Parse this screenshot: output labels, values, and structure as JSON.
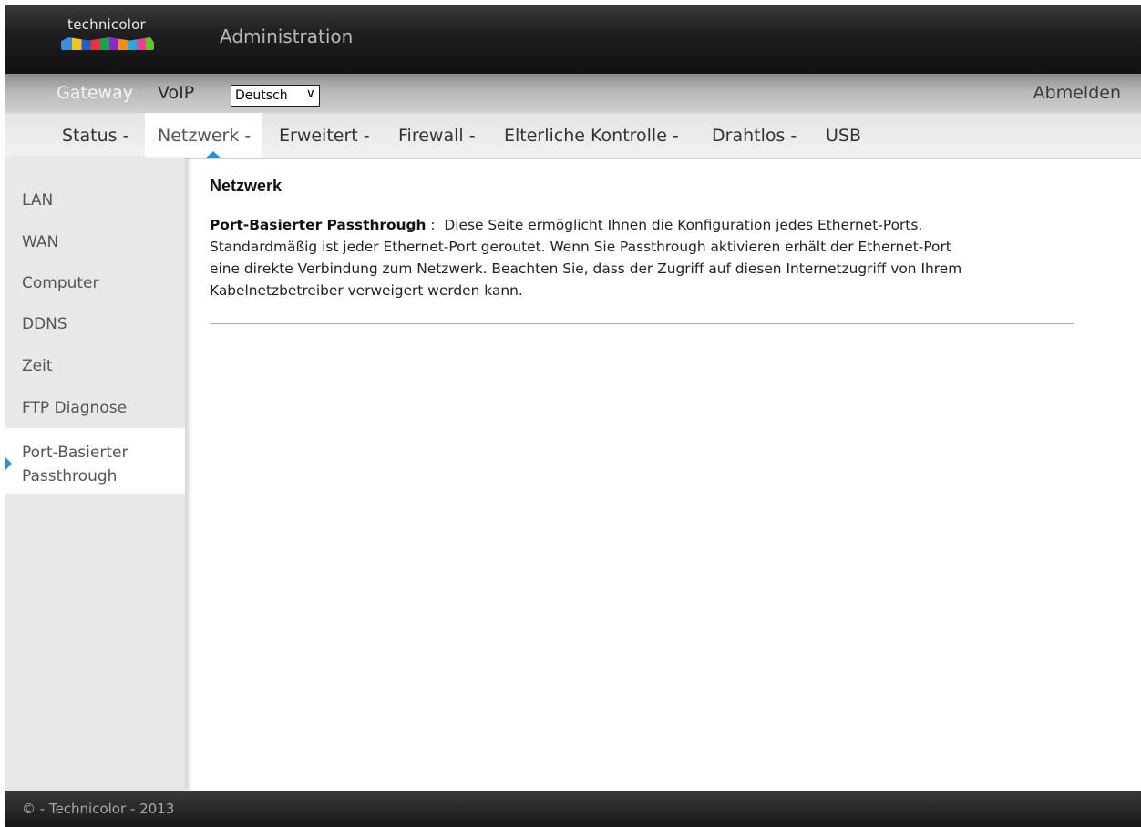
{
  "header": {
    "logo_text": "technicolor",
    "title": "Administration"
  },
  "topbar": {
    "gateway": "Gateway",
    "voip": "VoIP",
    "language": "Deutsch",
    "logout": "Abmelden"
  },
  "nav": {
    "items": [
      {
        "label": "Status -"
      },
      {
        "label": "Netzwerk -"
      },
      {
        "label": "Erweitert -"
      },
      {
        "label": "Firewall -"
      },
      {
        "label": "Elterliche Kontrolle -"
      },
      {
        "label": "Drahtlos -"
      },
      {
        "label": "USB"
      }
    ],
    "active": "Netzwerk -"
  },
  "sidebar": {
    "items": [
      {
        "label": "LAN"
      },
      {
        "label": "WAN"
      },
      {
        "label": "Computer"
      },
      {
        "label": "DDNS"
      },
      {
        "label": "Zeit"
      },
      {
        "label": "FTP Diagnose"
      },
      {
        "label_line1": "Port-Basierter",
        "label_line2": "Passthrough"
      }
    ],
    "active": "Port-Basierter Passthrough"
  },
  "content": {
    "title": "Netzwerk",
    "lead_bold": "Port-Basierter Passthrough",
    "separator": " : ",
    "line1": "Diese Seite ermöglicht Ihnen die Konfiguration jedes Ethernet-Ports.",
    "line2": "Standardmäßig ist jeder Ethernet-Port geroutet. Wenn Sie Passthrough aktivieren erhält der Ethernet-Port",
    "line3": "eine direkte Verbindung zum Netzwerk. Beachten Sie, dass der Zugriff auf diesen Internetzugriff von Ihrem",
    "line4": "Kabelnetzbetreiber verweigert werden kann."
  },
  "footer": {
    "text": "© - Technicolor - 2013"
  },
  "colors": {
    "accent": "#2a8fd8",
    "header_bg": "#1f1f1f",
    "sidebar_bg": "#e8e8e8"
  }
}
